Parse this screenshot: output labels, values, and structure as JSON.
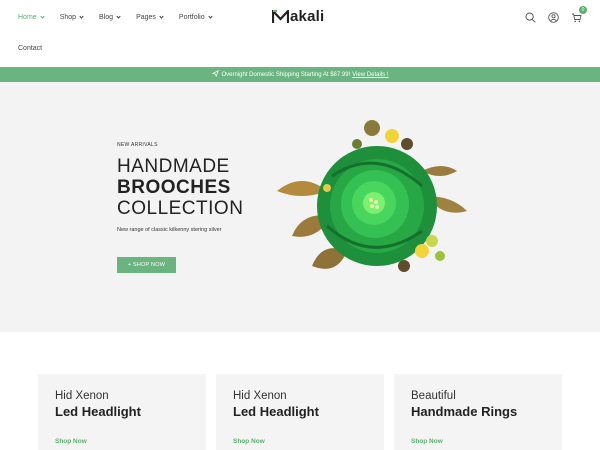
{
  "nav": {
    "items": [
      {
        "label": "Home",
        "active": true
      },
      {
        "label": "Shop",
        "active": false
      },
      {
        "label": "Blog",
        "active": false
      },
      {
        "label": "Pages",
        "active": false
      },
      {
        "label": "Portfolio",
        "active": false
      }
    ],
    "contact": "Contact"
  },
  "logo": {
    "text": "akali",
    "mark": "M"
  },
  "header_icons": [
    "search-icon",
    "user-icon",
    "cart-icon"
  ],
  "cart": {
    "count": "0"
  },
  "announcement": {
    "text": "Overnight Domestic Shipping Starting At $87.99!",
    "link": "View Details !"
  },
  "hero": {
    "eyebrow": "NEW ARRIVALS",
    "line1": "HANDMADE",
    "line2": "BROOCHES",
    "line3": "COLLECTION",
    "subtitle": "New range of classic kilkenny stering silver",
    "cta": "+ SHOP NOW"
  },
  "cards": [
    {
      "line1": "Hid Xenon",
      "line2": "Led Headlight",
      "link": "Shop Now"
    },
    {
      "line1": "Hid Xenon",
      "line2": "Led Headlight",
      "link": "Shop Now"
    },
    {
      "line1": "Beautiful",
      "line2": "Handmade Rings",
      "link": "Shop Now"
    }
  ],
  "colors": {
    "accent": "#6ab47f",
    "text": "#222222",
    "hero_bg": "#f3f3f3"
  }
}
